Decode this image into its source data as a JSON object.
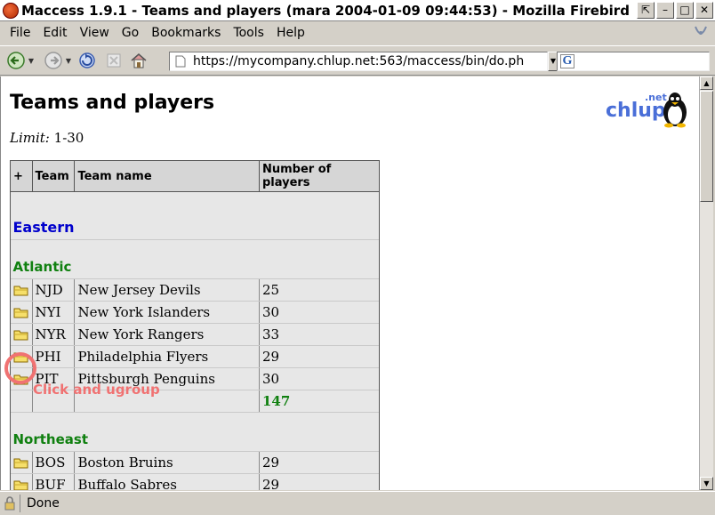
{
  "window": {
    "title": "Maccess 1.9.1 - Teams and players (mara 2004-01-09 09:44:53) - Mozilla Firebird",
    "buttons": [
      "⇱",
      "–",
      "□",
      "✕"
    ]
  },
  "menu": [
    "File",
    "Edit",
    "View",
    "Go",
    "Bookmarks",
    "Tools",
    "Help"
  ],
  "toolbar": {
    "url": "https://mycompany.chlup.net:563/maccess/bin/do.ph",
    "search_glyph": "G",
    "search_value": ""
  },
  "page": {
    "title": "Teams and players",
    "logo_main": "chlup",
    "logo_net": ".net",
    "limit_label": "Limit:",
    "limit_value": "1-30"
  },
  "table": {
    "headers": [
      "+",
      "Team",
      "Team name",
      "Number of players"
    ],
    "groups": [
      {
        "conference": "Eastern",
        "divisions": [
          {
            "name": "Atlantic",
            "rows": [
              {
                "code": "NJD",
                "name": "New Jersey Devils",
                "players": "25"
              },
              {
                "code": "NYI",
                "name": "New York Islanders",
                "players": "30"
              },
              {
                "code": "NYR",
                "name": "New York Rangers",
                "players": "33"
              },
              {
                "code": "PHI",
                "name": "Philadelphia Flyers",
                "players": "29"
              },
              {
                "code": "PIT",
                "name": "Pittsburgh Penguins",
                "players": "30"
              }
            ],
            "total": "147"
          },
          {
            "name": "Northeast",
            "rows": [
              {
                "code": "BOS",
                "name": "Boston Bruins",
                "players": "29"
              },
              {
                "code": "BUF",
                "name": "Buffalo Sabres",
                "players": "29"
              }
            ]
          }
        ]
      }
    ]
  },
  "annotation": {
    "text": "Click and ugroup",
    "color": "#f07272"
  },
  "status": {
    "text": "Done"
  }
}
